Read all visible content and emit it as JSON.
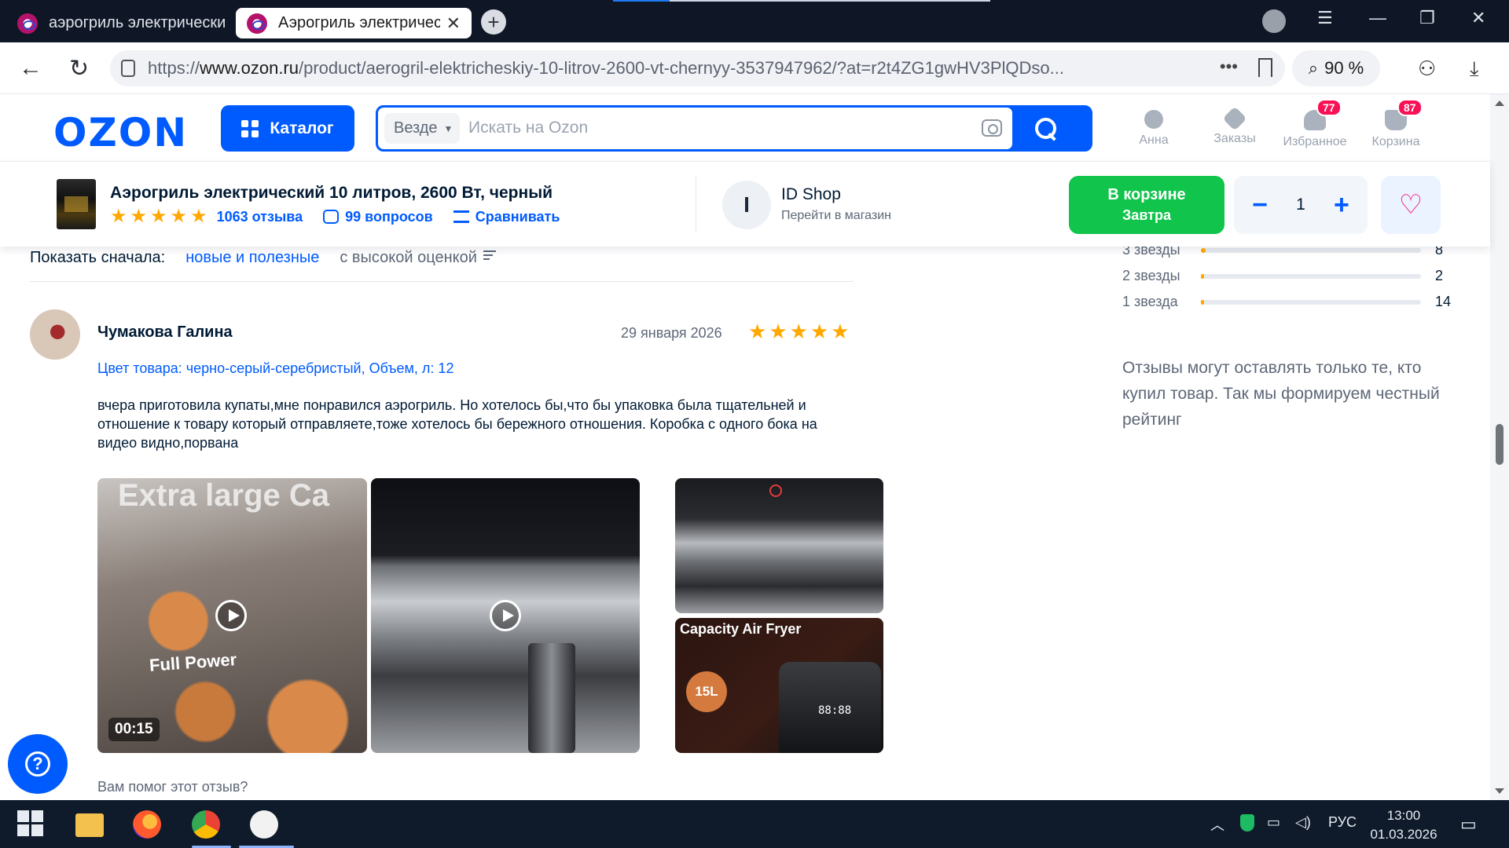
{
  "browser": {
    "tabs": [
      {
        "label": "аэрогриль электрический",
        "active": false
      },
      {
        "label": "Аэрогриль электричес",
        "active": true
      }
    ],
    "url_prefix": "https://",
    "url_domain": "www.ozon.ru",
    "url_path": "/product/aerogril-elektricheskiy-10-litrov-2600-vt-chernyy-3537947962/?at=r2t4ZG1gwHV3PlQDso...",
    "zoom": "90 %"
  },
  "header": {
    "logo": "OZON",
    "catalog_label": "Каталог",
    "search_scope": "Везде",
    "search_placeholder": "Искать на Ozon",
    "user_label": "Анна",
    "orders_label": "Заказы",
    "favorites_label": "Избранное",
    "favorites_count": "77",
    "cart_label": "Корзина",
    "cart_count": "87"
  },
  "product_bar": {
    "title": "Аэрогриль электрический 10 литров, 2600 Вт, черный",
    "rating_stars": 5,
    "reviews_link": "1063 отзыва",
    "questions_link": "99 вопросов",
    "compare_link": "Сравнивать",
    "shop_initial": "I",
    "shop_name": "ID Shop",
    "shop_link": "Перейти в магазин",
    "cart_btn_line1": "В корзине",
    "cart_btn_line2": "Завтра",
    "quantity": "1"
  },
  "sort": {
    "label": "Показать сначала:",
    "option_active": "новые и полезные",
    "option_other": "с высокой оценкой"
  },
  "review": {
    "author": "Чумакова Галина",
    "date": "29 января 2026",
    "stars": 5,
    "variant": "Цвет товара: черно-серый-серебристый, Объем, л: 12",
    "text": "вчера приготовила купаты,мне понравился аэрогриль. Но хотелось бы,что бы упаковка была тщательней и отношение к товару который отправляете,тоже хотелось бы бережного отношения. Коробка с одного бока на видео видно,порвана",
    "media1_text": "Extra large Ca",
    "media1_sub": "Full Power",
    "video_duration": "00:15",
    "media4_caption": "Capacity Air Fryer",
    "media4_badge": "15L",
    "media4_display": "88:88",
    "helpful_question": "Вам помог этот отзыв?"
  },
  "rating_breakdown": [
    {
      "label": "3 звезды",
      "count": "8",
      "fraction": 0.02
    },
    {
      "label": "2 звезды",
      "count": "2",
      "fraction": 0.006
    },
    {
      "label": "1 звезда",
      "count": "14",
      "fraction": 0.015
    }
  ],
  "notice": "Отзывы могут оставлять только те, кто купил товар. Так мы формируем честный рейтинг",
  "taskbar": {
    "lang": "РУС",
    "time": "13:00",
    "date": "01.03.2026"
  },
  "colors": {
    "brand": "#005bff",
    "cart_green": "#10c44c",
    "star": "#ffa800",
    "badge": "#f91155"
  }
}
